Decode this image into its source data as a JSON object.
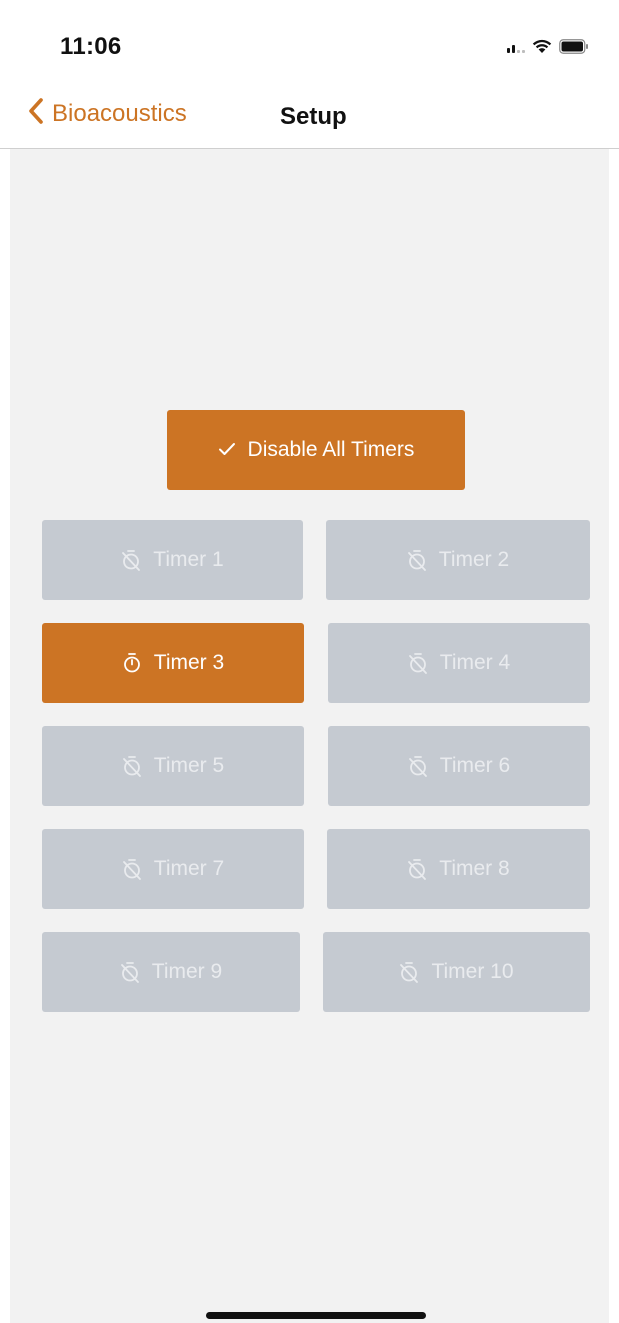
{
  "status_bar": {
    "time": "11:06"
  },
  "nav": {
    "back_label": "Bioacoustics",
    "title": "Setup"
  },
  "disable_all": {
    "label": "Disable All Timers"
  },
  "timers": [
    {
      "label": "Timer 1",
      "active": false
    },
    {
      "label": "Timer 2",
      "active": false
    },
    {
      "label": "Timer 3",
      "active": true
    },
    {
      "label": "Timer 4",
      "active": false
    },
    {
      "label": "Timer 5",
      "active": false
    },
    {
      "label": "Timer 6",
      "active": false
    },
    {
      "label": "Timer 7",
      "active": false
    },
    {
      "label": "Timer 8",
      "active": false
    },
    {
      "label": "Timer 9",
      "active": false
    },
    {
      "label": "Timer 10",
      "active": false
    }
  ],
  "icons": {
    "back": "chevron-left-icon",
    "disable_all": "checkmark-icon",
    "timer_off": "timer-off-icon",
    "timer_on": "timer-icon"
  },
  "colors": {
    "accent": "#cc7424",
    "inactive_button": "#c5cad1",
    "background": "#f2f2f2"
  }
}
